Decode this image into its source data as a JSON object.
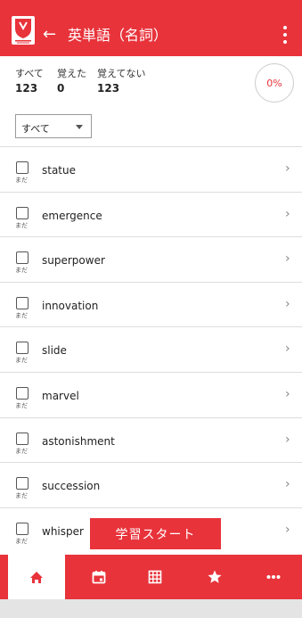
{
  "header": {
    "title": "英単語（名詞）",
    "back_label": "←"
  },
  "stats": {
    "all_label": "すべて",
    "all_value": "123",
    "learned_label": "覚えた",
    "learned_value": "0",
    "not_learned_label": "覚えてない",
    "not_learned_value": "123",
    "progress_text": "0%"
  },
  "filter": {
    "selected": "すべて"
  },
  "words": {
    "status_label": "まだ",
    "items": [
      "statue",
      "emergence",
      "superpower",
      "innovation",
      "slide",
      "marvel",
      "astonishment",
      "succession",
      "whisper"
    ]
  },
  "start_button_label": "学習スタート",
  "bottom_nav": {
    "icons": [
      "home-icon",
      "calendar-icon",
      "grid-icon",
      "star-icon",
      "more-icon"
    ]
  },
  "colors": {
    "accent": "#e8333b"
  }
}
